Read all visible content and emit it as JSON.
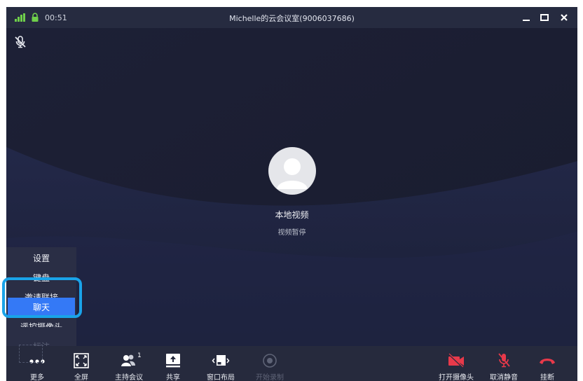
{
  "titlebar": {
    "timer": "00:51",
    "title": "Michelle的云会议室(9006037686)"
  },
  "video": {
    "label": "本地视频",
    "status": "视频暂停"
  },
  "more_menu": {
    "items": [
      {
        "label": "设置"
      },
      {
        "label": "键盘"
      },
      {
        "label": "邀请联接"
      },
      {
        "label": "聊天"
      },
      {
        "label": "遥控摄像头"
      },
      {
        "label": "标注"
      }
    ]
  },
  "toolbar": {
    "more": "更多",
    "fullscreen": "全屏",
    "host": "主持会议",
    "host_count": "1",
    "share": "共享",
    "layout": "窗口布局",
    "record": "开始录制",
    "camera": "打开摄像头",
    "unmute": "取消静音",
    "hangup": "挂断"
  },
  "colors": {
    "accent": "#3479f6",
    "highlight_ring": "#1aa3e8",
    "hangup": "#e8394a",
    "signal": "#6fcf4b"
  }
}
